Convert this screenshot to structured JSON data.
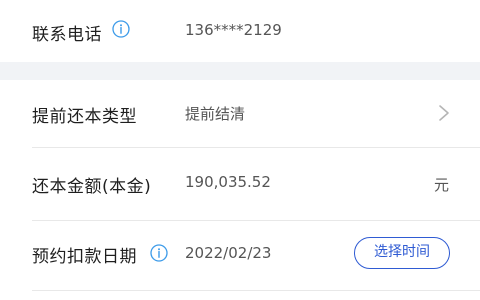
{
  "contact": {
    "label": "联系电话",
    "phone": "136****2129",
    "info_icon": "info-icon"
  },
  "prepay_type": {
    "label": "提前还本类型",
    "value": "提前结清",
    "chevron_icon": "chevron-right-icon"
  },
  "principal_amount": {
    "label": "还本金额(本金)",
    "value": "190,035.52",
    "unit": "元"
  },
  "scheduled_date": {
    "label": "预约扣款日期",
    "value": "2022/02/23",
    "info_icon": "info-icon",
    "button_label": "选择时间"
  },
  "colors": {
    "accent": "#2f5bd3",
    "info_icon": "#3d9be9",
    "section_gap": "#f1f3f6"
  }
}
